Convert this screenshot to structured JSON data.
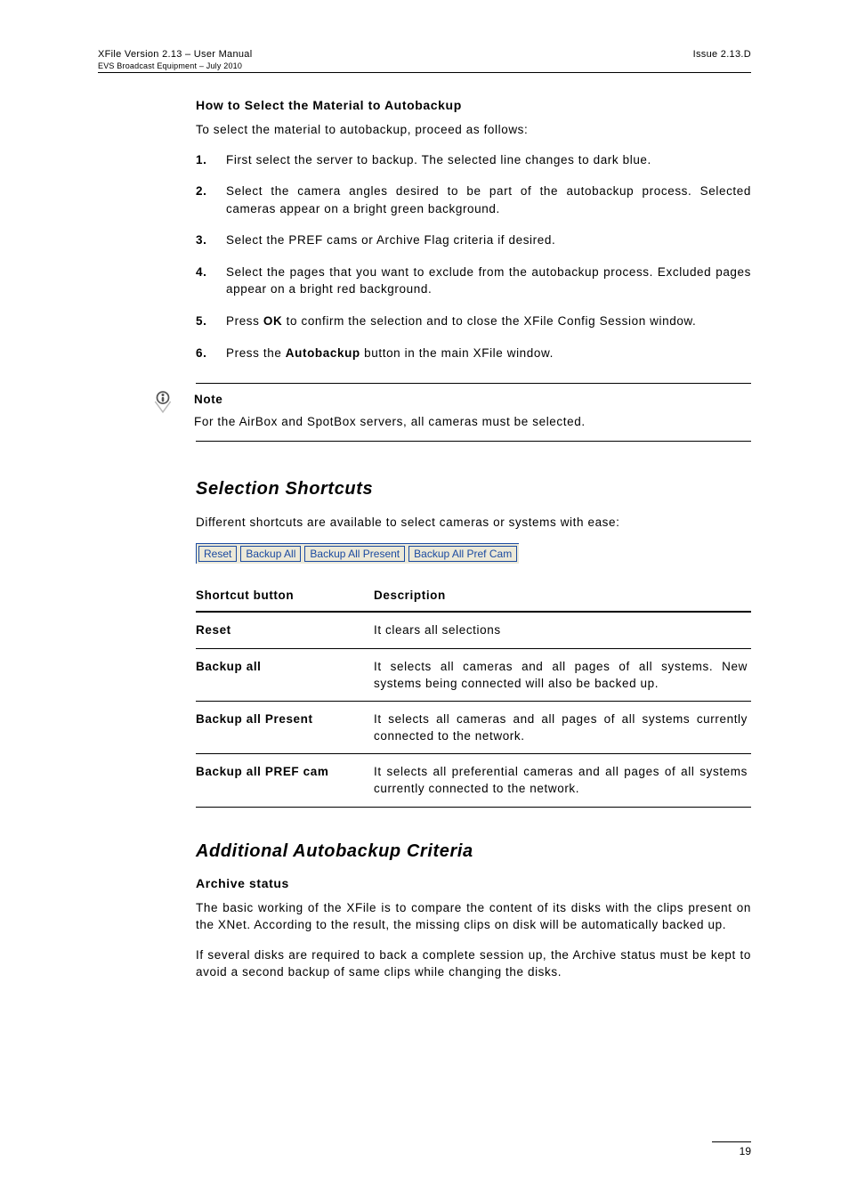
{
  "header": {
    "left_line1": "XFile Version 2.13 – User Manual",
    "left_line2": "EVS Broadcast Equipment – July 2010",
    "right": "Issue 2.13.D"
  },
  "howto": {
    "title": "How to Select the Material to Autobackup",
    "intro": "To select the material to autobackup, proceed as follows:",
    "steps": [
      "First select the server to backup. The selected line changes to dark blue.",
      "Select the camera angles desired to be part of the autobackup process. Selected cameras appear on a bright green background.",
      "Select the PREF cams or Archive Flag criteria if desired.",
      "Select the pages that you want to exclude from the autobackup process. Excluded pages appear on a bright red background.",
      "Press OK to confirm the selection and to close the XFile Config Session window.",
      "Press the Autobackup button in the main XFile window."
    ]
  },
  "note": {
    "label": "Note",
    "text": "For the AirBox and SpotBox servers, all cameras must be selected."
  },
  "shortcuts": {
    "heading": "Selection Shortcuts",
    "intro": "Different shortcuts are available to select cameras or systems with ease:",
    "buttons": [
      "Reset",
      "Backup All",
      "Backup All Present",
      "Backup All Pref Cam"
    ],
    "table_headers": {
      "c1": "Shortcut button",
      "c2": "Description"
    },
    "rows": [
      {
        "name": "Reset",
        "desc": "It clears all selections"
      },
      {
        "name": "Backup all",
        "desc": "It selects all cameras and all pages of all systems. New systems being connected will also be backed up."
      },
      {
        "name": "Backup all Present",
        "desc": "It selects all cameras and all pages of all systems currently connected to the network."
      },
      {
        "name": "Backup all PREF cam",
        "desc": "It selects all preferential cameras and all pages of all systems currently connected to the network."
      }
    ]
  },
  "additional": {
    "heading": "Additional Autobackup Criteria",
    "sub": "Archive status",
    "p1": "The basic working of the XFile is to compare the content of its disks with the clips present on the XNet. According to the result, the missing clips on disk will be automatically backed up.",
    "p2": "If several disks are required to back a complete session up, the Archive status must be kept to avoid a second backup of same clips while changing the disks."
  },
  "footer": {
    "page": "19"
  }
}
